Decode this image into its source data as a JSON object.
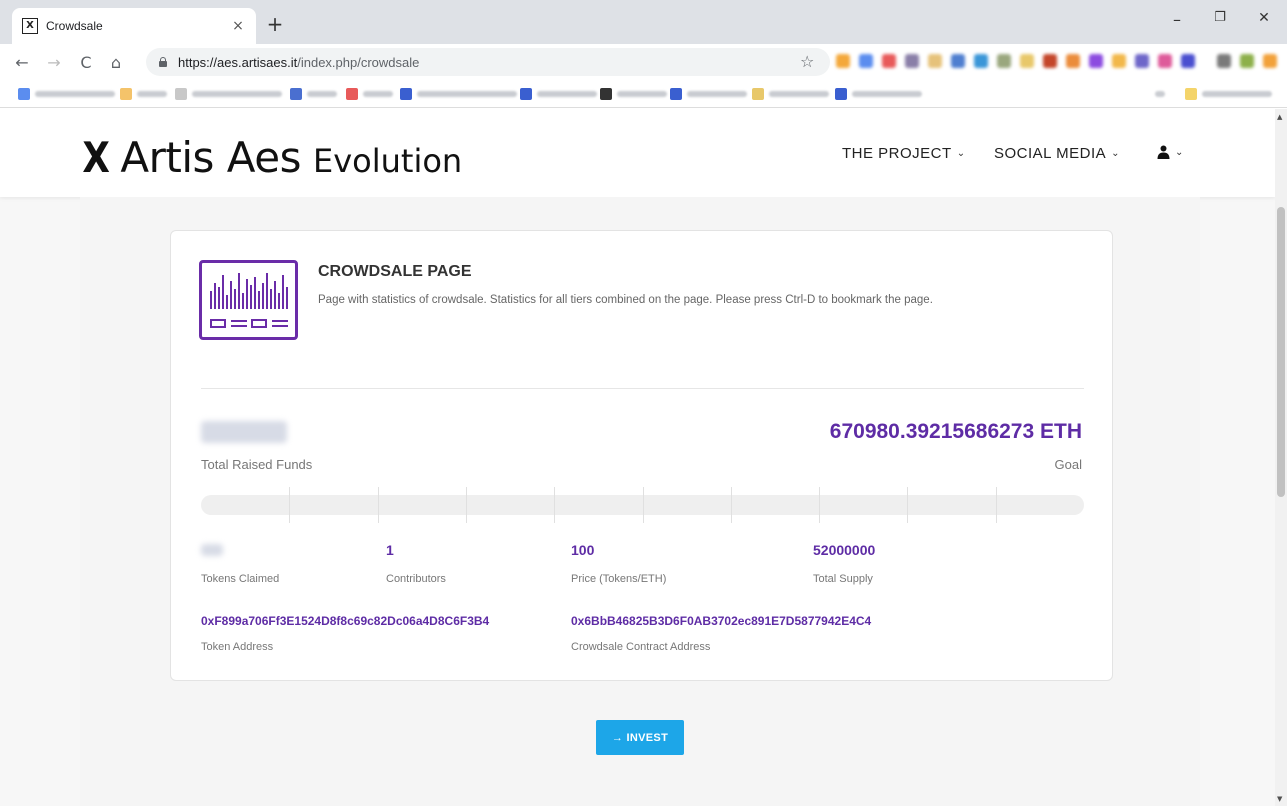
{
  "browser": {
    "tab_title": "Crowdsale",
    "tab_close": "×",
    "new_tab": "+",
    "url_host": "https://aes.artisaes.it",
    "url_path": "/index.php/crowdsale",
    "minimize": "–",
    "restore": "❐",
    "close": "✕",
    "back": "←",
    "forward": "→",
    "reload": "C",
    "home": "⌂",
    "bookmark_star": "☆",
    "favicon": "X"
  },
  "site": {
    "logo_mark": "X",
    "logo_main": "Artis Aes",
    "logo_sub": "Evolution",
    "nav": {
      "project": "THE PROJECT",
      "social": "SOCIAL MEDIA",
      "chevron": "⌄",
      "user_icon": "user-icon"
    }
  },
  "crowdsale": {
    "title": "CROWDSALE PAGE",
    "description": "Page with statistics of crowdsale. Statistics for all tiers combined on the page. Please press Ctrl-D to bookmark the page.",
    "total_raised_label": "Total Raised Funds",
    "goal_value": "670980.39215686273 ETH",
    "goal_label": "Goal",
    "progress_fraction": 0,
    "stats": {
      "tokens_claimed_label": "Tokens Claimed",
      "contributors_value": "1",
      "contributors_label": "Contributors",
      "price_value": "100",
      "price_label": "Price (Tokens/ETH)",
      "supply_value": "52000000",
      "supply_label": "Total Supply"
    },
    "token_address": "0xF899a706Ff3E1524D8f8c69c82Dc06a4D8C6F3B4",
    "token_address_label": "Token Address",
    "contract_address": "0x6BbB46825B3D6F0AB3702ec891E7D5877942E4C4",
    "contract_address_label": "Crowdsale Contract Address",
    "invest_label": "→ INVEST"
  },
  "colors": {
    "accent_purple": "#5e2ca5",
    "invest_blue": "#1da6e8"
  }
}
